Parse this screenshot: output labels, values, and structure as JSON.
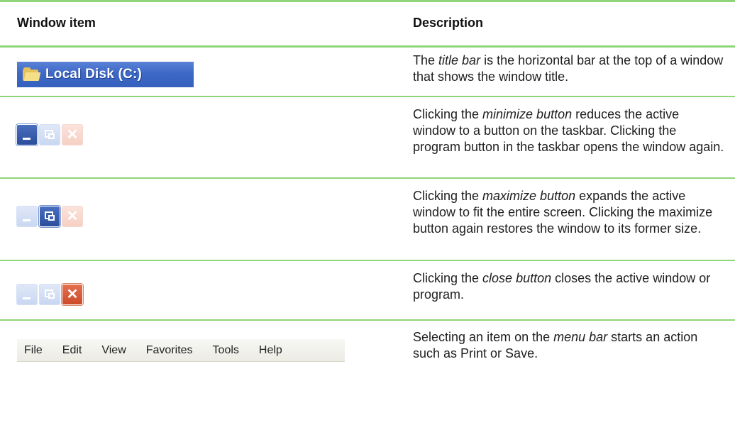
{
  "header": {
    "col1": "Window item",
    "col2": "Description"
  },
  "rows": [
    {
      "item": "title-bar",
      "title_text": "Local Disk (C:)",
      "desc_pre": "The ",
      "desc_em": "title bar",
      "desc_post": " is the horizontal bar at the top of a window that shows the window title."
    },
    {
      "item": "minimize-button",
      "desc_pre": "Clicking the ",
      "desc_em": "minimize button",
      "desc_post": " reduces the active window to a button on the taskbar. Clicking the program button in the taskbar opens the window again."
    },
    {
      "item": "maximize-button",
      "desc_pre": "Clicking the ",
      "desc_em": "maximize button",
      "desc_post": " expands the active window to fit the entire screen. Clicking the maximize button again restores the window to its former size."
    },
    {
      "item": "close-button",
      "desc_pre": "Clicking the ",
      "desc_em": "close button",
      "desc_post": " closes the active window or program."
    },
    {
      "item": "menu-bar",
      "menu_items": [
        "File",
        "Edit",
        "View",
        "Favorites",
        "Tools",
        "Help"
      ],
      "desc_pre": "Selecting an item on the ",
      "desc_em": "menu bar",
      "desc_post": " starts an action such as Print or Save."
    }
  ],
  "colors": {
    "rule": "#8fd67a",
    "titlebar": "#3d68c6",
    "close_red": "#cd4a2a"
  },
  "icons": {
    "folder": "folder-icon",
    "minimize": "minimize-icon",
    "maximize": "restore-icon",
    "close": "close-icon"
  },
  "glyphs": {
    "close": "✕"
  }
}
